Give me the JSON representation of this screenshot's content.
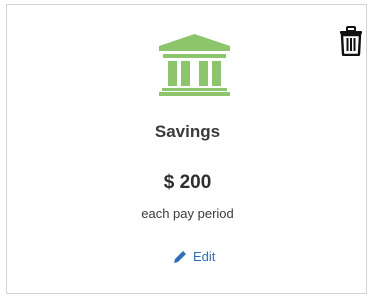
{
  "card": {
    "icon": "bank-icon",
    "name": "Savings",
    "amount": "$ 200",
    "frequency": "each pay period",
    "edit_label": "Edit",
    "delete_icon": "trash-icon",
    "edit_icon": "pencil-icon"
  },
  "colors": {
    "icon_green": "#8cc56c",
    "link_blue": "#2f6fb6",
    "text_dark": "#333333",
    "border": "#d3d3d3"
  }
}
